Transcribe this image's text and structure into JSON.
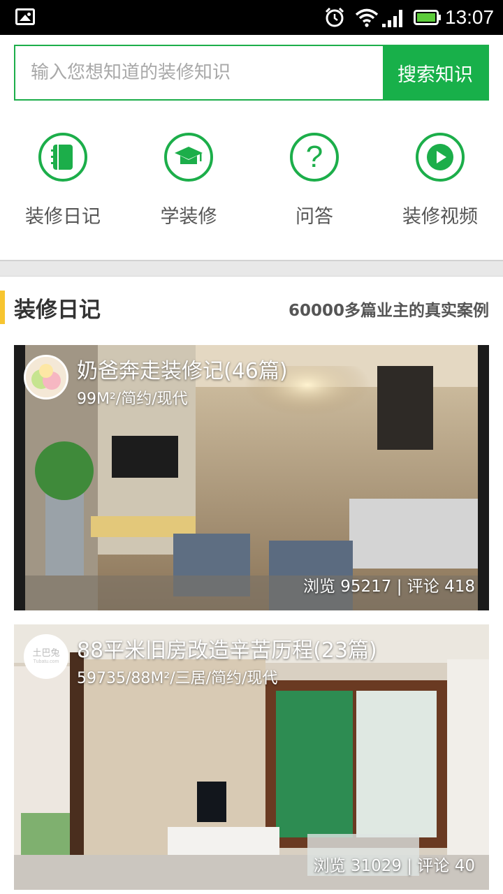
{
  "status_bar": {
    "time": "13:07",
    "icons": [
      "gallery-icon",
      "alarm-icon",
      "wifi-icon",
      "signal-icon",
      "battery-icon"
    ]
  },
  "search": {
    "placeholder": "输入您想知道的装修知识",
    "value": "",
    "button_label": "搜索知识"
  },
  "categories": [
    {
      "label": "装修日记",
      "icon": "notebook-icon"
    },
    {
      "label": "学装修",
      "icon": "graduation-cap-icon"
    },
    {
      "label": "问答",
      "icon": "question-icon"
    },
    {
      "label": "装修视频",
      "icon": "play-icon"
    }
  ],
  "section": {
    "title": "装修日记",
    "subtitle": "60000多篇业主的真实案例"
  },
  "diaries": [
    {
      "title": "奶爸奔走装修记(46篇)",
      "meta": "99M²/简约/现代",
      "stats": "浏览 95217 | 评论 418"
    },
    {
      "title": "88平米旧房改造辛苦历程(23篇)",
      "meta": "59735/88M²/三居/简约/现代",
      "stats": "浏览 31029 | 评论 40",
      "avatar_text": "土巴兔 Tubatu.com"
    }
  ],
  "colors": {
    "brand_green": "#18b04a",
    "section_accent": "#f7c530",
    "divider": "#e8e8e8"
  }
}
